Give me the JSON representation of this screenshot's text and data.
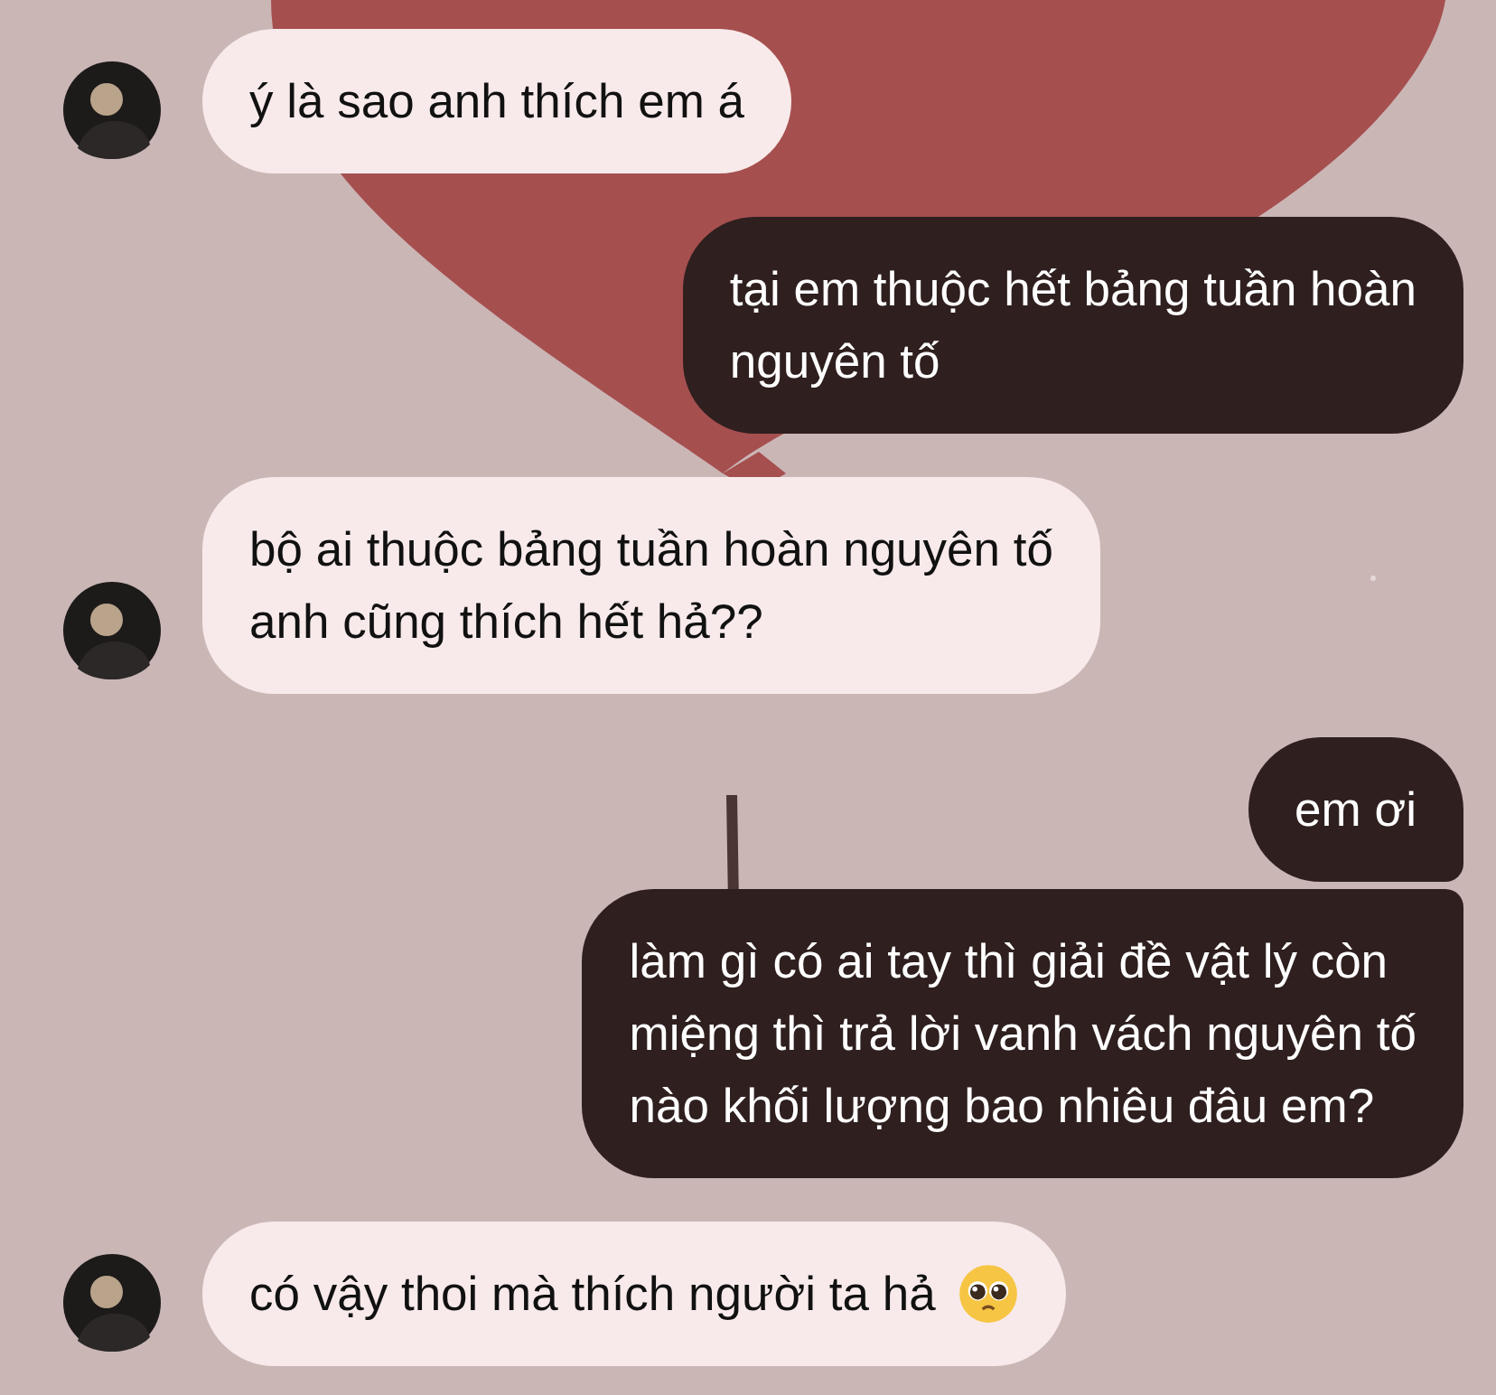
{
  "messages": [
    {
      "kind": "them",
      "lines": [
        "ý là sao anh thích em á"
      ]
    },
    {
      "kind": "me",
      "lines": [
        "tại em thuộc hết bảng tuần hoàn",
        "nguyên tố"
      ]
    },
    {
      "kind": "them",
      "lines": [
        "bộ ai thuộc bảng tuần hoàn nguyên tố",
        "anh cũng thích hết hả??"
      ]
    },
    {
      "kind": "me",
      "lines": [
        "em ơi"
      ]
    },
    {
      "kind": "me",
      "lines": [
        "làm gì có ai tay thì giải đề vật lý còn",
        "miệng thì trả lời vanh vách nguyên tố",
        "nào khối lượng bao nhiêu đâu em?"
      ]
    },
    {
      "kind": "them",
      "lines": [
        "có vậy thoi mà thích người ta hả"
      ],
      "emoji": true
    }
  ]
}
